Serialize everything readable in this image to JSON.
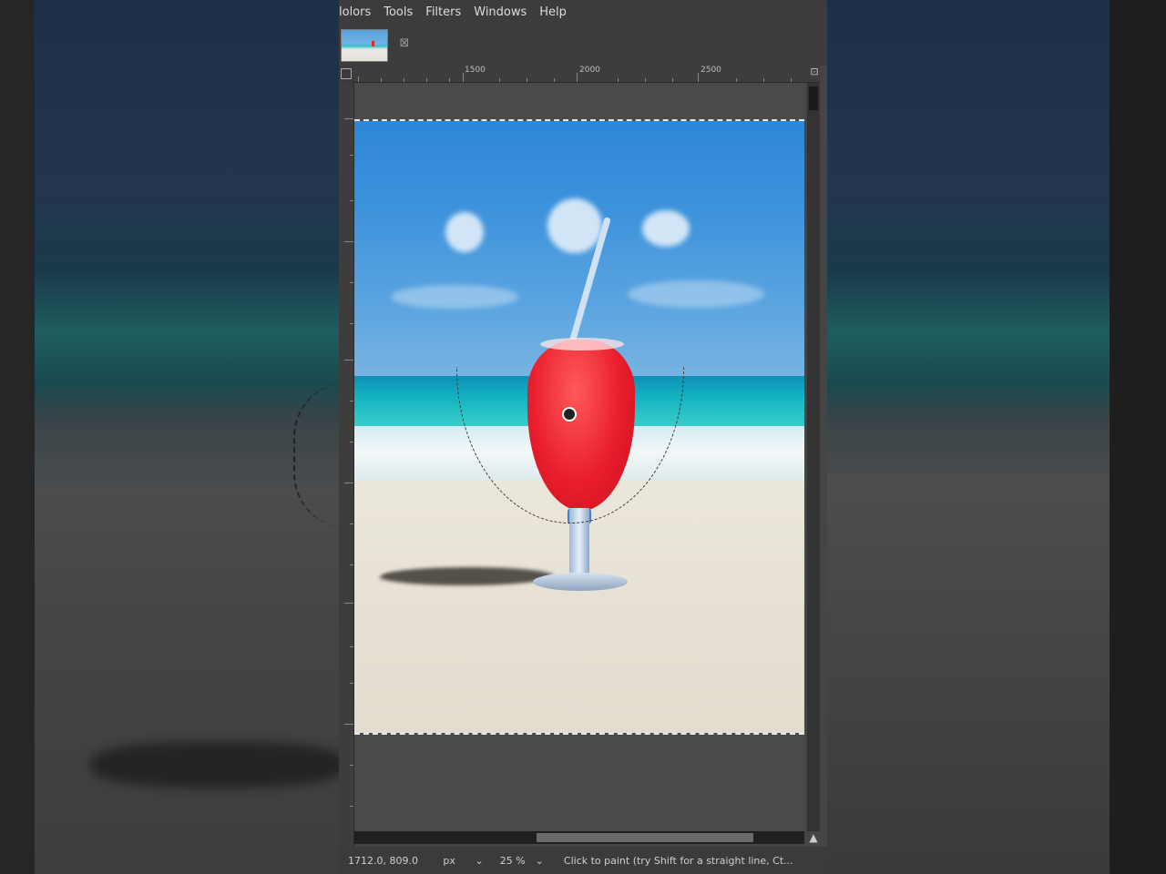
{
  "menubar": {
    "items": [
      "lolors",
      "Tools",
      "Filters",
      "Windows",
      "Help"
    ]
  },
  "tab": {
    "close_icon": "close-icon"
  },
  "ruler": {
    "h_labels": [
      "1500",
      "2000",
      "2500"
    ]
  },
  "statusbar": {
    "coordinates": "1712.0, 809.0",
    "unit": "px",
    "zoom": "25 %",
    "message": "Click to paint (try Shift for a straight line, Ct..."
  },
  "colors": {
    "menubar_bg": "#3c3c3c",
    "canvas_bg": "#4a4a4a",
    "drink_red": "#e81c2c",
    "sky_blue": "#2e86d8"
  }
}
